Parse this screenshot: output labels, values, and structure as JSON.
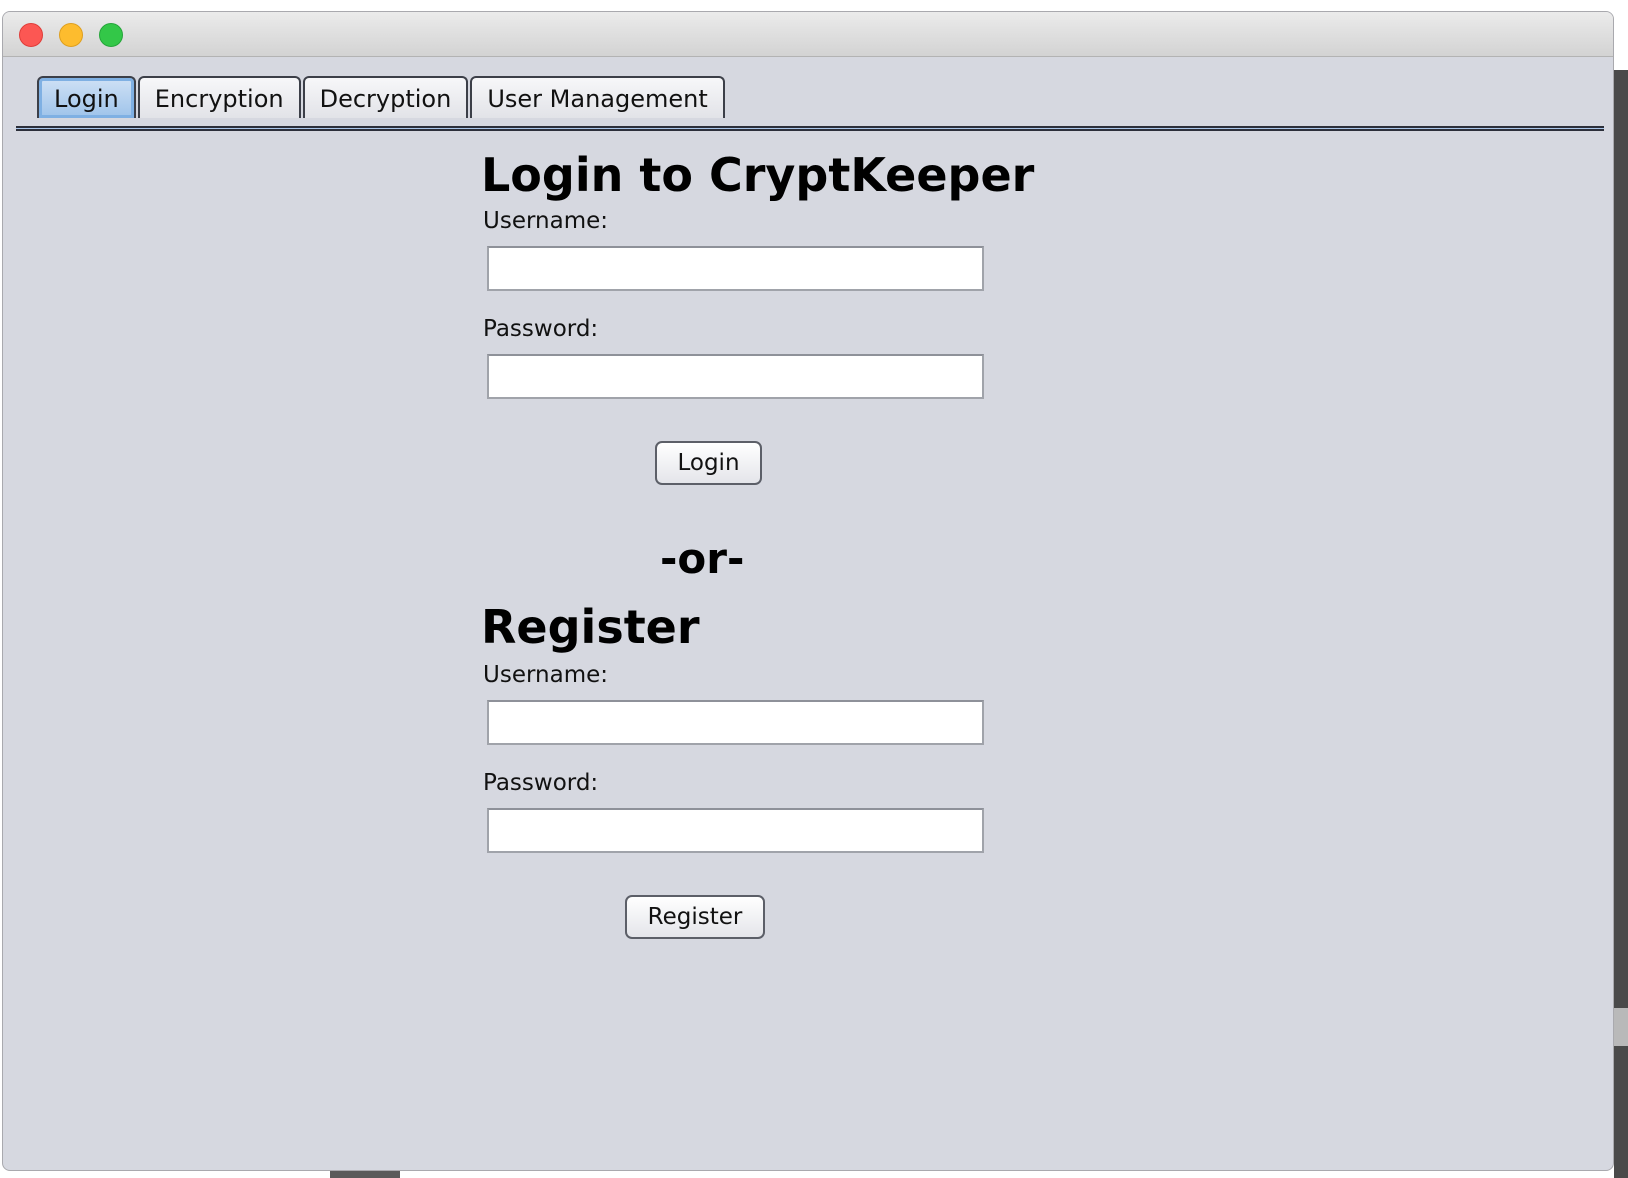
{
  "tabs": [
    {
      "label": "Login",
      "active": true
    },
    {
      "label": "Encryption",
      "active": false
    },
    {
      "label": "Decryption",
      "active": false
    },
    {
      "label": "User Management",
      "active": false
    }
  ],
  "login": {
    "heading": "Login to CryptKeeper",
    "username_label": "Username:",
    "username_value": "",
    "password_label": "Password:",
    "password_value": "",
    "button_label": "Login"
  },
  "separator": "-or-",
  "register": {
    "heading": "Register",
    "username_label": "Username:",
    "username_value": "",
    "password_label": "Password:",
    "password_value": "",
    "button_label": "Register"
  },
  "colors": {
    "window_background": "#d6d8e0",
    "active_tab": "#9ec3ea",
    "close": "#fc5753",
    "minimize": "#fdbc2e",
    "maximize": "#33c748"
  }
}
